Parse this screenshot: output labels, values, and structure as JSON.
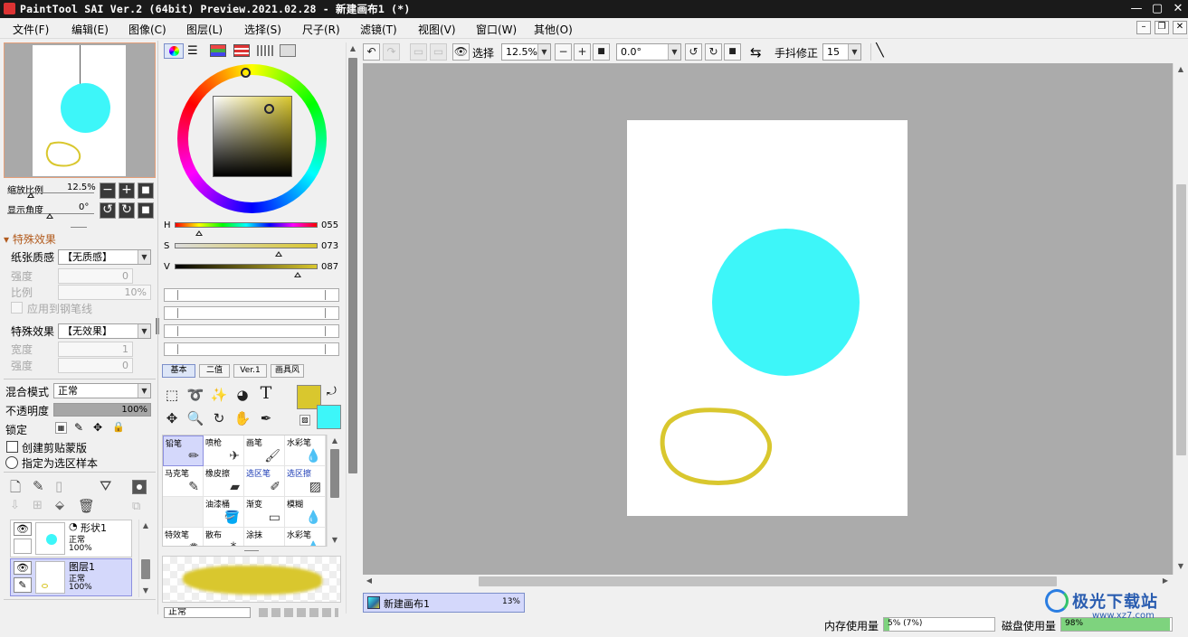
{
  "window": {
    "title": "PaintTool SAI Ver.2 (64bit) Preview.2021.02.28 - 新建画布1 (*)",
    "min": "—",
    "max": "▢",
    "close": "✕"
  },
  "menu": [
    "文件(F)",
    "编辑(E)",
    "图像(C)",
    "图层(L)",
    "选择(S)",
    "尺子(R)",
    "滤镜(T)",
    "视图(V)",
    "窗口(W)",
    "其他(O)"
  ],
  "navigator": {
    "zoom_label": "缩放比例",
    "zoom_value": "12.5%",
    "angle_label": "显示角度",
    "angle_value": "0°"
  },
  "effects": {
    "header": "特殊效果",
    "paper_label": "纸张质感",
    "paper_value": "【无质感】",
    "strength_label": "强度",
    "strength_value": "0",
    "ratio_label": "比例",
    "ratio_value": "10%",
    "apply_label": "应用到钢笔线",
    "effect_label": "特殊效果",
    "effect_value": "【无效果】",
    "width_label": "宽度",
    "width_value": "1",
    "strength2_label": "强度",
    "strength2_value": "0"
  },
  "layer_props": {
    "blend_label": "混合模式",
    "blend_value": "正常",
    "opacity_label": "不透明度",
    "opacity_value": "100%",
    "opacity": 1.0,
    "lock_label": "锁定",
    "clip_label": "创建剪贴蒙版",
    "sample_label": "指定为选区样本"
  },
  "layers": [
    {
      "name": "形状1",
      "mode": "正常",
      "opacity": "100%"
    },
    {
      "name": "图层1",
      "mode": "正常",
      "opacity": "100%"
    }
  ],
  "color": {
    "h_label": "H",
    "h_value": "055",
    "s_label": "S",
    "s_value": "073",
    "v_label": "V",
    "v_value": "087",
    "primary": "#d9c72e",
    "secondary": "#3df6f9"
  },
  "tool_tabs": [
    "基本",
    "二值",
    "Ver.1",
    "画具风"
  ],
  "brushes": [
    {
      "name": "铅笔",
      "icon": "pencil-icon"
    },
    {
      "name": "喷枪",
      "icon": "airbrush-icon"
    },
    {
      "name": "画笔",
      "icon": "brush-icon"
    },
    {
      "name": "水彩笔",
      "icon": "watercolor-icon"
    },
    {
      "name": "马克笔",
      "icon": "marker-icon"
    },
    {
      "name": "橡皮擦",
      "icon": "eraser-icon"
    },
    {
      "name": "选区笔",
      "icon": "selection-pen-icon"
    },
    {
      "name": "选区擦",
      "icon": "selection-eraser-icon"
    },
    {
      "name": "",
      "icon": ""
    },
    {
      "name": "油漆桶",
      "icon": "bucket-icon"
    },
    {
      "name": "渐变",
      "icon": "gradient-icon"
    },
    {
      "name": "模糊",
      "icon": "blur-icon"
    },
    {
      "name": "特效笔",
      "icon": "effect-pen-icon"
    },
    {
      "name": "散布",
      "icon": "scatter-icon"
    },
    {
      "name": "涂抹",
      "icon": "smudge-icon"
    },
    {
      "name": "水彩笔",
      "icon": "watercolor-icon"
    }
  ],
  "brush_mode": "正常",
  "toolbar": {
    "select_label": "选择",
    "zoom_value": "12.5%",
    "angle_value": "0.0°",
    "stabilizer_label": "手抖修正",
    "stabilizer_value": "15"
  },
  "canvas_tab": {
    "name": "新建画布1",
    "zoom": "13%"
  },
  "status": {
    "mem_label": "内存使用量",
    "mem_value": "5% (7%)",
    "disk_label": "磁盘使用量",
    "disk_value": "98%"
  },
  "watermark": {
    "text": "极光下载站",
    "url": "www.xz7.com"
  }
}
